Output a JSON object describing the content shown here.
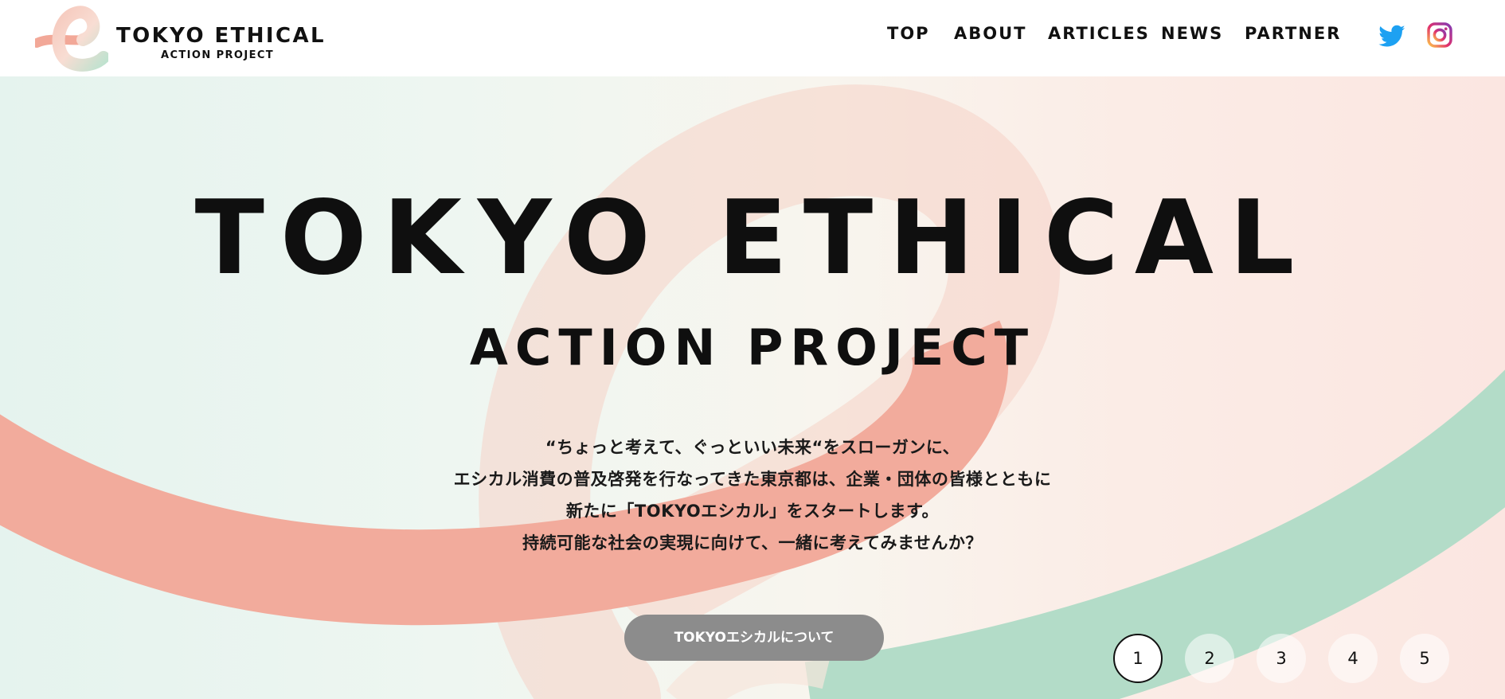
{
  "header": {
    "logo": {
      "title": "TOKYO ETHICAL",
      "subtitle": "ACTION PROJECT"
    },
    "nav": [
      {
        "label": "TOP"
      },
      {
        "label": "ABOUT"
      },
      {
        "label": "ARTICLES"
      },
      {
        "label": "NEWS"
      },
      {
        "label": "PARTNER"
      }
    ],
    "social": [
      {
        "icon": "twitter-icon",
        "color": "#1da1f2"
      },
      {
        "icon": "instagram-icon",
        "color": "#e1306c"
      }
    ]
  },
  "hero": {
    "title": "TOKYO ETHICAL",
    "subtitle": "ACTION PROJECT",
    "copy": [
      "“ちょっと考えて、ぐっといい未来“をスローガンに、",
      "エシカル消費の普及啓発を行なってきた東京都は、企業・団体の皆様とともに",
      "新たに「TOKYOエシカル」をスタートします。",
      "持続可能な社会の実現に向けて、一緒に考えてみませんか？"
    ],
    "button_label": "TOKYOエシカルについて",
    "pager": [
      {
        "label": "1",
        "active": true
      },
      {
        "label": "2",
        "active": false
      },
      {
        "label": "3",
        "active": false
      },
      {
        "label": "4",
        "active": false
      },
      {
        "label": "5",
        "active": false
      }
    ]
  },
  "colors": {
    "coral": "#f2ab9c",
    "mint": "#b3dcc8",
    "button": "#8c8c8c"
  }
}
